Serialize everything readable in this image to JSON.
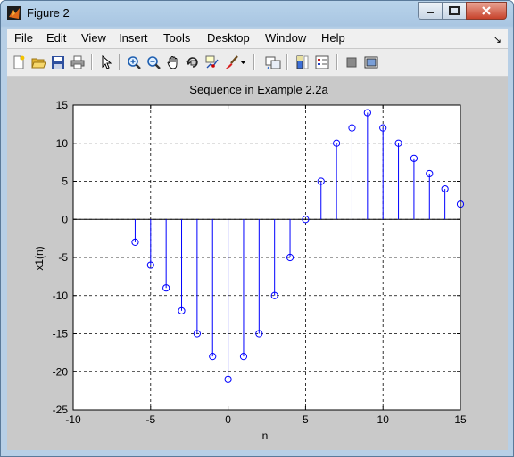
{
  "window": {
    "title": "Figure 2"
  },
  "menu": [
    "File",
    "Edit",
    "View",
    "Insert",
    "Tools",
    "Desktop",
    "Window",
    "Help"
  ],
  "toolbar": {
    "icons": [
      "new-figure-icon",
      "open-file-icon",
      "save-icon",
      "print-icon",
      "edit-plot-pointer-icon",
      "zoom-in-icon",
      "zoom-out-icon",
      "pan-hand-icon",
      "rotate-3d-icon",
      "data-cursor-icon",
      "brush-icon",
      "brush-dropdown-icon",
      "link-plot-icon",
      "insert-colorbar-icon",
      "insert-legend-icon",
      "hide-plot-tools-icon",
      "show-plot-tools-icon"
    ]
  },
  "colors": {
    "stem": "#0000ff",
    "plot_bg": "#ffffff",
    "figure_bg": "#c9c9c9"
  },
  "chart_data": {
    "type": "stem",
    "title": "Sequence in Example 2.2a",
    "xlabel": "n",
    "ylabel": "x1(n)",
    "xlim": [
      -10,
      15
    ],
    "ylim": [
      -25,
      15
    ],
    "xticks": [
      -10,
      -5,
      0,
      5,
      10,
      15
    ],
    "yticks": [
      15,
      10,
      5,
      0,
      -5,
      -10,
      -15,
      -20,
      -25
    ],
    "grid": true,
    "x": [
      -6,
      -5,
      -4,
      -3,
      -2,
      -1,
      0,
      1,
      2,
      3,
      4,
      5,
      6,
      7,
      8,
      9,
      10,
      11,
      12,
      13,
      14,
      15
    ],
    "y": [
      -3,
      -6,
      -9,
      -12,
      -15,
      -18,
      -21,
      -18,
      -15,
      -10,
      -5,
      0,
      5,
      10,
      12,
      14,
      12,
      10,
      8,
      6,
      4,
      2
    ]
  }
}
